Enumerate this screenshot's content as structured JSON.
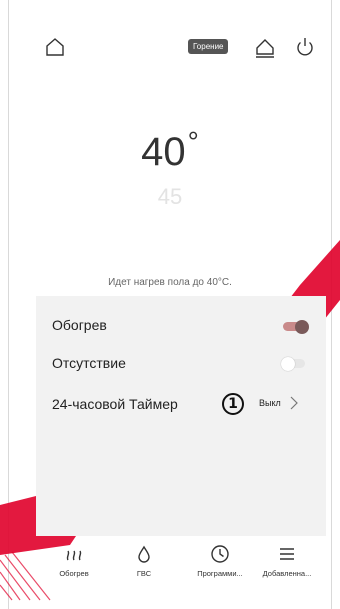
{
  "header": {
    "badge": "Горение",
    "icons": [
      "home-icon",
      "boiler-icon",
      "power-icon"
    ]
  },
  "temperature": {
    "current": "40",
    "degree": "°",
    "target": "45"
  },
  "status_text": "Идет нагрев пола до 40°C.",
  "settings": {
    "heating": {
      "label": "Обогрев",
      "state": "on"
    },
    "away": {
      "label": "Отсутствие",
      "state": "off"
    },
    "timer": {
      "label": "24-часовой Таймер",
      "value": "Выкл",
      "marker": "1"
    }
  },
  "nav": {
    "heating": "Обогрев",
    "hot_water": "ГВС",
    "programs": "Программи...",
    "added": "Добавленна..."
  },
  "colors": {
    "watermark": "#e0002a",
    "toggle_on_track": "#c98a8a",
    "toggle_on_knob": "#7a5a5a",
    "badge_bg": "#555555"
  }
}
